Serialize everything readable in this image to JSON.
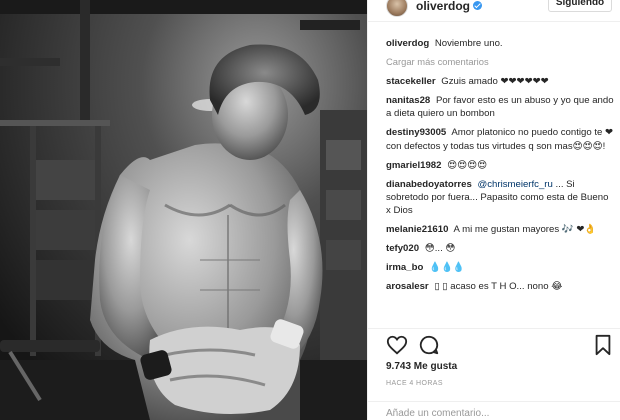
{
  "header": {
    "username": "oliverdog",
    "follow_label": "Siguiendo",
    "avatar_icon": "profile-avatar",
    "verified_icon": "verified-badge"
  },
  "caption": {
    "username": "oliverdog",
    "text": "Noviembre uno."
  },
  "load_more": "Cargar más comentarios",
  "comments": [
    {
      "user": "stacekeller",
      "text": "Gzuis amado ❤❤❤❤❤❤"
    },
    {
      "user": "nanitas28",
      "text": "Por favor esto es un abuso y yo que ando a dieta quiero un bombon"
    },
    {
      "user": "destiny93005",
      "text": "Amor platonico no puedo contigo te ❤ con defectos y todas tus virtudes q son mas😍😍😍!"
    },
    {
      "user": "gmariel1982",
      "text": "😍😍😍😍"
    },
    {
      "user": "dianabedoyatorres",
      "mention": "@chrismeierfc_ru",
      "text": "... Si sobretodo por fuera... Papasito como esta de Bueno x Dios"
    },
    {
      "user": "melanie21610",
      "text": "A mi me gustan mayores 🎶 ❤👌"
    },
    {
      "user": "tefy020",
      "text": "😳... 😳"
    },
    {
      "user": "irma_bo",
      "text": "💧💧💧"
    },
    {
      "user": "arosalesr",
      "text": "▯ ▯ acaso es T H O... nono 😂"
    }
  ],
  "actions": {
    "like_icon": "heart-icon",
    "comment_icon": "comment-icon",
    "save_icon": "bookmark-icon"
  },
  "likes": "9.743 Me gusta",
  "timestamp": "HACE 4 HORAS",
  "add_comment_placeholder": "Añade un comentario..."
}
